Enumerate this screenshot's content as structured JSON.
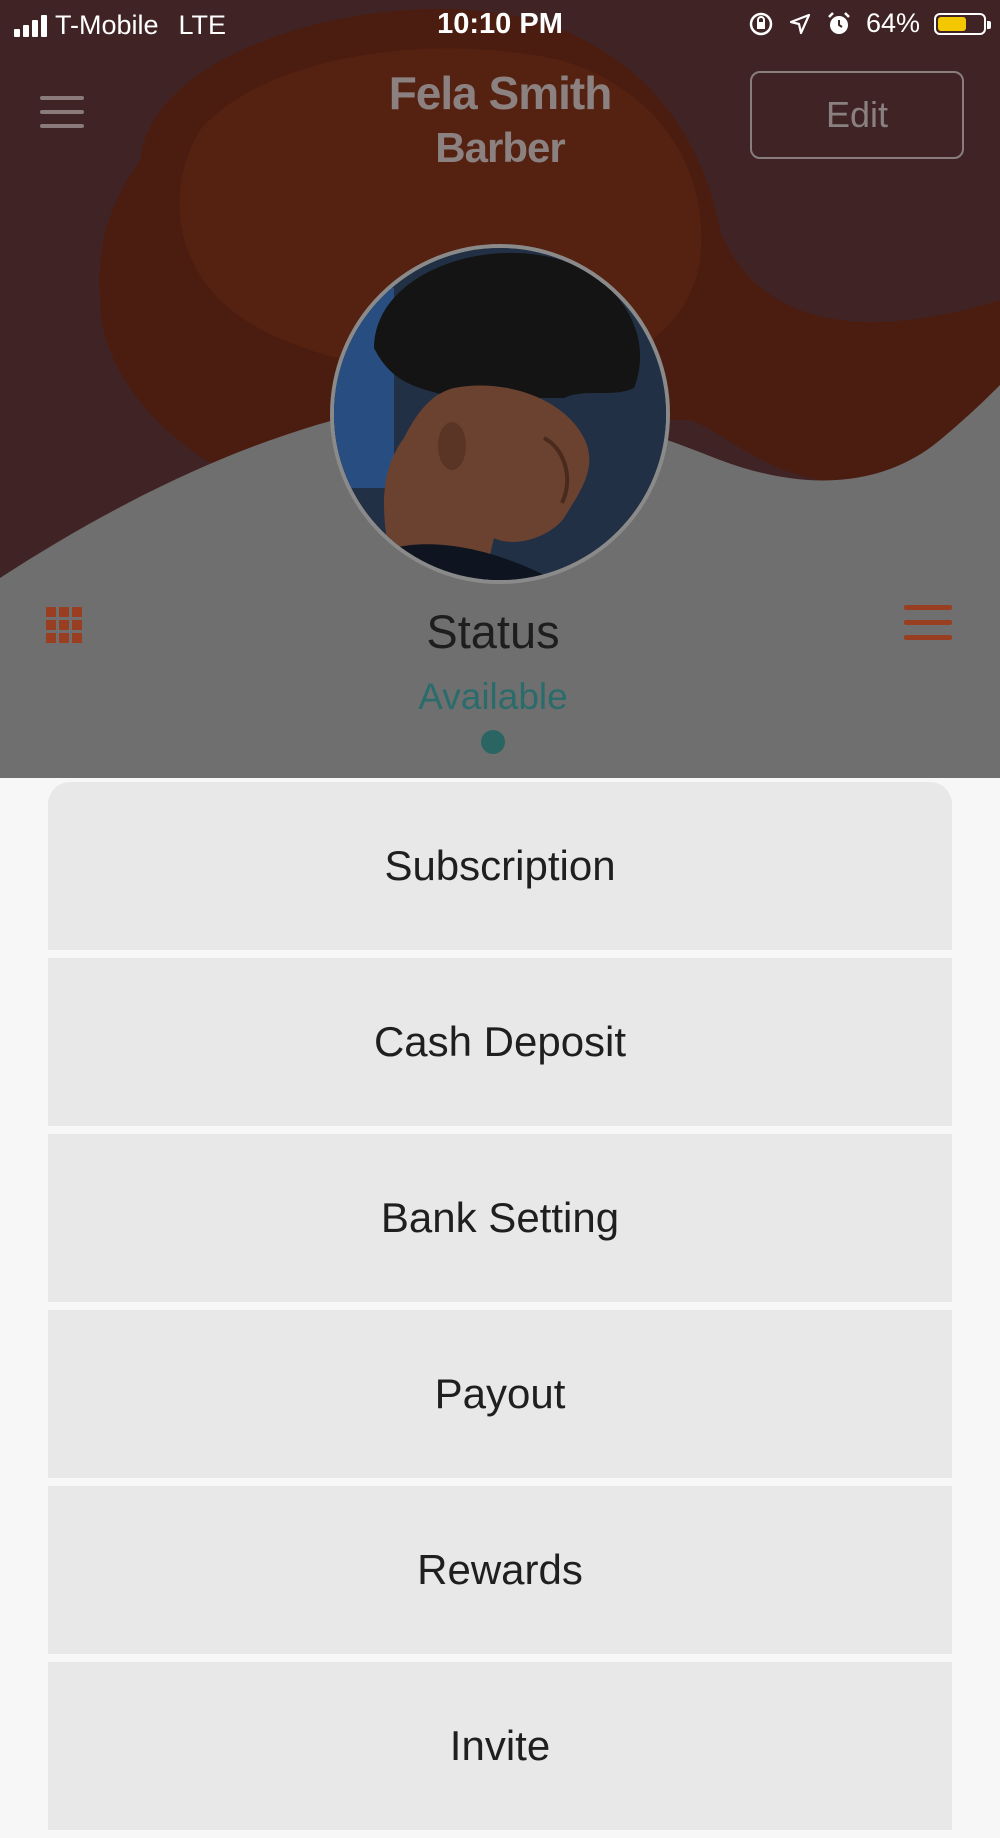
{
  "status_bar": {
    "carrier": "T-Mobile",
    "network": "LTE",
    "time": "10:10 PM",
    "battery_percent": "64%",
    "battery_level": 0.64
  },
  "header": {
    "name": "Fela Smith",
    "role": "Barber",
    "edit_label": "Edit"
  },
  "status": {
    "title": "Status",
    "value": "Available"
  },
  "menu": [
    {
      "label": "Subscription"
    },
    {
      "label": "Cash Deposit"
    },
    {
      "label": "Bank Setting"
    },
    {
      "label": "Payout"
    },
    {
      "label": "Rewards"
    },
    {
      "label": "Invite"
    }
  ],
  "colors": {
    "accent_orange": "#9a3e22",
    "status_teal": "#2a6c6b",
    "battery_yellow": "#f4c800"
  },
  "icons": {
    "menu": "hamburger-icon",
    "grid": "grid-view-icon",
    "list": "list-view-icon",
    "lock": "rotation-lock-icon",
    "location": "location-arrow-icon",
    "alarm": "alarm-clock-icon"
  }
}
